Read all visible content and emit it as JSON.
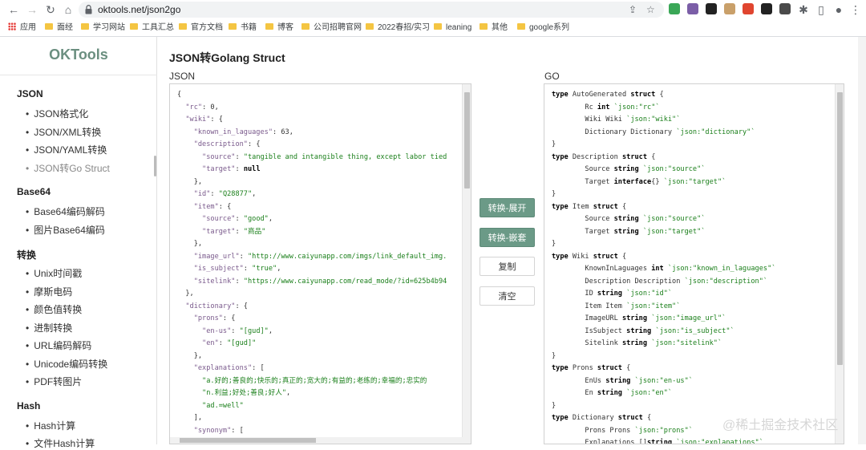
{
  "browser": {
    "url": "oktools.net/json2go",
    "bookmarks": [
      {
        "label": "应用",
        "kind": "apps"
      },
      {
        "label": "面经",
        "kind": "folder"
      },
      {
        "label": "学习网站",
        "kind": "folder"
      },
      {
        "label": "工具汇总",
        "kind": "folder"
      },
      {
        "label": "官方文档",
        "kind": "folder"
      },
      {
        "label": "书籍",
        "kind": "folder"
      },
      {
        "label": "博客",
        "kind": "folder"
      },
      {
        "label": "公司招聘官网",
        "kind": "folder"
      },
      {
        "label": "2022春招/实习",
        "kind": "folder"
      },
      {
        "label": "leaning",
        "kind": "folder"
      },
      {
        "label": "其他",
        "kind": "folder"
      },
      {
        "label": "google系列",
        "kind": "folder"
      }
    ],
    "extension_colors": [
      "#3aa757",
      "#7b5ea7",
      "#222222",
      "#c9a06a",
      "#e0452f",
      "#222222",
      "#4a4a4a"
    ]
  },
  "sidebar": {
    "logo": "OKTools",
    "sections": [
      {
        "title": "JSON",
        "items": [
          "JSON格式化",
          "JSON/XML转换",
          "JSON/YAML转换",
          "JSON转Go Struct"
        ]
      },
      {
        "title": "Base64",
        "items": [
          "Base64编码解码",
          "图片Base64编码"
        ]
      },
      {
        "title": "转换",
        "items": [
          "Unix时间戳",
          "摩斯电码",
          "颜色值转换",
          "进制转换",
          "URL编码解码",
          "Unicode编码转换",
          "PDF转图片"
        ]
      },
      {
        "title": "Hash",
        "items": [
          "Hash计算",
          "文件Hash计算"
        ]
      }
    ],
    "active_item": "JSON转Go Struct"
  },
  "main": {
    "title": "JSON转Golang Struct",
    "json_label": "JSON",
    "go_label": "GO",
    "buttons": {
      "expand": "转换-展开",
      "nested": "转换-嵌套",
      "copy": "复制",
      "clear": "清空"
    }
  },
  "json_lines": [
    [
      [
        "n",
        "{"
      ]
    ],
    [
      [
        "n",
        "  "
      ],
      [
        "k",
        "\"rc\""
      ],
      [
        "n",
        ": 0,"
      ]
    ],
    [
      [
        "n",
        "  "
      ],
      [
        "k",
        "\"wiki\""
      ],
      [
        "n",
        ": {"
      ]
    ],
    [
      [
        "n",
        "    "
      ],
      [
        "k",
        "\"known_in_laguages\""
      ],
      [
        "n",
        ": 63,"
      ]
    ],
    [
      [
        "n",
        "    "
      ],
      [
        "k",
        "\"description\""
      ],
      [
        "n",
        ": {"
      ]
    ],
    [
      [
        "n",
        "      "
      ],
      [
        "k",
        "\"source\""
      ],
      [
        "n",
        ": "
      ],
      [
        "s",
        "\"tangible and intangible thing, except labor tied"
      ]
    ],
    [
      [
        "n",
        "      "
      ],
      [
        "k",
        "\"target\""
      ],
      [
        "n",
        ": "
      ],
      [
        "kw",
        "null"
      ]
    ],
    [
      [
        "n",
        "    },"
      ]
    ],
    [
      [
        "n",
        "    "
      ],
      [
        "k",
        "\"id\""
      ],
      [
        "n",
        ": "
      ],
      [
        "s",
        "\"Q28877\""
      ],
      [
        "n",
        ","
      ]
    ],
    [
      [
        "n",
        "    "
      ],
      [
        "k",
        "\"item\""
      ],
      [
        "n",
        ": {"
      ]
    ],
    [
      [
        "n",
        "      "
      ],
      [
        "k",
        "\"source\""
      ],
      [
        "n",
        ": "
      ],
      [
        "s",
        "\"good\""
      ],
      [
        "n",
        ","
      ]
    ],
    [
      [
        "n",
        "      "
      ],
      [
        "k",
        "\"target\""
      ],
      [
        "n",
        ": "
      ],
      [
        "s",
        "\"商品\""
      ]
    ],
    [
      [
        "n",
        "    },"
      ]
    ],
    [
      [
        "n",
        "    "
      ],
      [
        "k",
        "\"image_url\""
      ],
      [
        "n",
        ": "
      ],
      [
        "s",
        "\"http://www.caiyunapp.com/imgs/link_default_img."
      ]
    ],
    [
      [
        "n",
        "    "
      ],
      [
        "k",
        "\"is_subject\""
      ],
      [
        "n",
        ": "
      ],
      [
        "s",
        "\"true\""
      ],
      [
        "n",
        ","
      ]
    ],
    [
      [
        "n",
        "    "
      ],
      [
        "k",
        "\"sitelink\""
      ],
      [
        "n",
        ": "
      ],
      [
        "s",
        "\"https://www.caiyunapp.com/read_mode/?id=625b4b94"
      ]
    ],
    [
      [
        "n",
        "  },"
      ]
    ],
    [
      [
        "n",
        "  "
      ],
      [
        "k",
        "\"dictionary\""
      ],
      [
        "n",
        ": {"
      ]
    ],
    [
      [
        "n",
        "    "
      ],
      [
        "k",
        "\"prons\""
      ],
      [
        "n",
        ": {"
      ]
    ],
    [
      [
        "n",
        "      "
      ],
      [
        "k",
        "\"en-us\""
      ],
      [
        "n",
        ": "
      ],
      [
        "s",
        "\"[gud]\""
      ],
      [
        "n",
        ","
      ]
    ],
    [
      [
        "n",
        "      "
      ],
      [
        "k",
        "\"en\""
      ],
      [
        "n",
        ": "
      ],
      [
        "s",
        "\"[gud]\""
      ]
    ],
    [
      [
        "n",
        "    },"
      ]
    ],
    [
      [
        "n",
        "    "
      ],
      [
        "k",
        "\"explanations\""
      ],
      [
        "n",
        ": ["
      ]
    ],
    [
      [
        "n",
        "      "
      ],
      [
        "s",
        "\"a.好的;善良的;快乐的;真正的;宽大的;有益的;老练的;幸福的;忠实的"
      ]
    ],
    [
      [
        "n",
        "      "
      ],
      [
        "s",
        "\"n.利益;好处;善良;好人\""
      ],
      [
        "n",
        ","
      ]
    ],
    [
      [
        "n",
        "      "
      ],
      [
        "s",
        "\"ad.=well\""
      ]
    ],
    [
      [
        "n",
        "    ],"
      ]
    ],
    [
      [
        "n",
        "    "
      ],
      [
        "k",
        "\"synonym\""
      ],
      [
        "n",
        ": ["
      ]
    ]
  ],
  "go_lines": [
    [
      [
        "kw",
        "type"
      ],
      [
        "id",
        " AutoGenerated "
      ],
      [
        "kw",
        "struct"
      ],
      [
        "id",
        " {"
      ]
    ],
    [
      [
        "id",
        "        Rc "
      ],
      [
        "kw",
        "int"
      ],
      [
        "id",
        " "
      ],
      [
        "tag",
        "`json:\"rc\"`"
      ]
    ],
    [
      [
        "id",
        "        Wiki Wiki "
      ],
      [
        "tag",
        "`json:\"wiki\"`"
      ]
    ],
    [
      [
        "id",
        "        Dictionary Dictionary "
      ],
      [
        "tag",
        "`json:\"dictionary\"`"
      ]
    ],
    [
      [
        "id",
        "}"
      ]
    ],
    [
      [
        "kw",
        "type"
      ],
      [
        "id",
        " Description "
      ],
      [
        "kw",
        "struct"
      ],
      [
        "id",
        " {"
      ]
    ],
    [
      [
        "id",
        "        Source "
      ],
      [
        "kw",
        "string"
      ],
      [
        "id",
        " "
      ],
      [
        "tag",
        "`json:\"source\"`"
      ]
    ],
    [
      [
        "id",
        "        Target "
      ],
      [
        "kw",
        "interface"
      ],
      [
        "id",
        "{} "
      ],
      [
        "tag",
        "`json:\"target\"`"
      ]
    ],
    [
      [
        "id",
        "}"
      ]
    ],
    [
      [
        "kw",
        "type"
      ],
      [
        "id",
        " Item "
      ],
      [
        "kw",
        "struct"
      ],
      [
        "id",
        " {"
      ]
    ],
    [
      [
        "id",
        "        Source "
      ],
      [
        "kw",
        "string"
      ],
      [
        "id",
        " "
      ],
      [
        "tag",
        "`json:\"source\"`"
      ]
    ],
    [
      [
        "id",
        "        Target "
      ],
      [
        "kw",
        "string"
      ],
      [
        "id",
        " "
      ],
      [
        "tag",
        "`json:\"target\"`"
      ]
    ],
    [
      [
        "id",
        "}"
      ]
    ],
    [
      [
        "kw",
        "type"
      ],
      [
        "id",
        " Wiki "
      ],
      [
        "kw",
        "struct"
      ],
      [
        "id",
        " {"
      ]
    ],
    [
      [
        "id",
        "        KnownInLaguages "
      ],
      [
        "kw",
        "int"
      ],
      [
        "id",
        " "
      ],
      [
        "tag",
        "`json:\"known_in_laguages\"`"
      ]
    ],
    [
      [
        "id",
        "        Description Description "
      ],
      [
        "tag",
        "`json:\"description\"`"
      ]
    ],
    [
      [
        "id",
        "        ID "
      ],
      [
        "kw",
        "string"
      ],
      [
        "id",
        " "
      ],
      [
        "tag",
        "`json:\"id\"`"
      ]
    ],
    [
      [
        "id",
        "        Item Item "
      ],
      [
        "tag",
        "`json:\"item\"`"
      ]
    ],
    [
      [
        "id",
        "        ImageURL "
      ],
      [
        "kw",
        "string"
      ],
      [
        "id",
        " "
      ],
      [
        "tag",
        "`json:\"image_url\"`"
      ]
    ],
    [
      [
        "id",
        "        IsSubject "
      ],
      [
        "kw",
        "string"
      ],
      [
        "id",
        " "
      ],
      [
        "tag",
        "`json:\"is_subject\"`"
      ]
    ],
    [
      [
        "id",
        "        Sitelink "
      ],
      [
        "kw",
        "string"
      ],
      [
        "id",
        " "
      ],
      [
        "tag",
        "`json:\"sitelink\"`"
      ]
    ],
    [
      [
        "id",
        "}"
      ]
    ],
    [
      [
        "kw",
        "type"
      ],
      [
        "id",
        " Prons "
      ],
      [
        "kw",
        "struct"
      ],
      [
        "id",
        " {"
      ]
    ],
    [
      [
        "id",
        "        EnUs "
      ],
      [
        "kw",
        "string"
      ],
      [
        "id",
        " "
      ],
      [
        "tag",
        "`json:\"en-us\"`"
      ]
    ],
    [
      [
        "id",
        "        En "
      ],
      [
        "kw",
        "string"
      ],
      [
        "id",
        " "
      ],
      [
        "tag",
        "`json:\"en\"`"
      ]
    ],
    [
      [
        "id",
        "}"
      ]
    ],
    [
      [
        "kw",
        "type"
      ],
      [
        "id",
        " Dictionary "
      ],
      [
        "kw",
        "struct"
      ],
      [
        "id",
        " {"
      ]
    ],
    [
      [
        "id",
        "        Prons Prons "
      ],
      [
        "tag",
        "`json:\"prons\"`"
      ]
    ],
    [
      [
        "id",
        "        Explanations []"
      ],
      [
        "kw",
        "string"
      ],
      [
        "id",
        " "
      ],
      [
        "tag",
        "`json:\"explanations\"`"
      ]
    ]
  ],
  "watermark": "@稀土掘金技术社区"
}
